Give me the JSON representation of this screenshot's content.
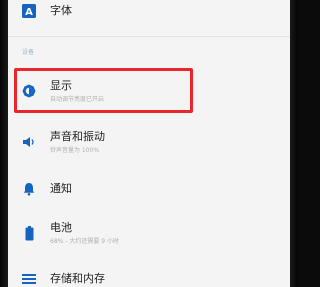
{
  "items": [
    {
      "title": "字体",
      "subtitle": "",
      "icon": "font-icon"
    },
    {
      "title": "显示",
      "subtitle": "自动调节亮度已开启",
      "icon": "brightness-icon"
    },
    {
      "title": "声音和振动",
      "subtitle": "铃声音量为 100%",
      "icon": "volume-icon"
    },
    {
      "title": "通知",
      "subtitle": "",
      "icon": "bell-icon"
    },
    {
      "title": "电池",
      "subtitle": "68% - 大约还需要 9 小时",
      "icon": "battery-icon"
    },
    {
      "title": "存储和内存",
      "subtitle": "",
      "icon": "storage-icon"
    }
  ],
  "section": {
    "label": "设备"
  },
  "colors": {
    "accent": "#1565c0",
    "highlight": "#e8262b",
    "background": "#f4f4f4"
  }
}
